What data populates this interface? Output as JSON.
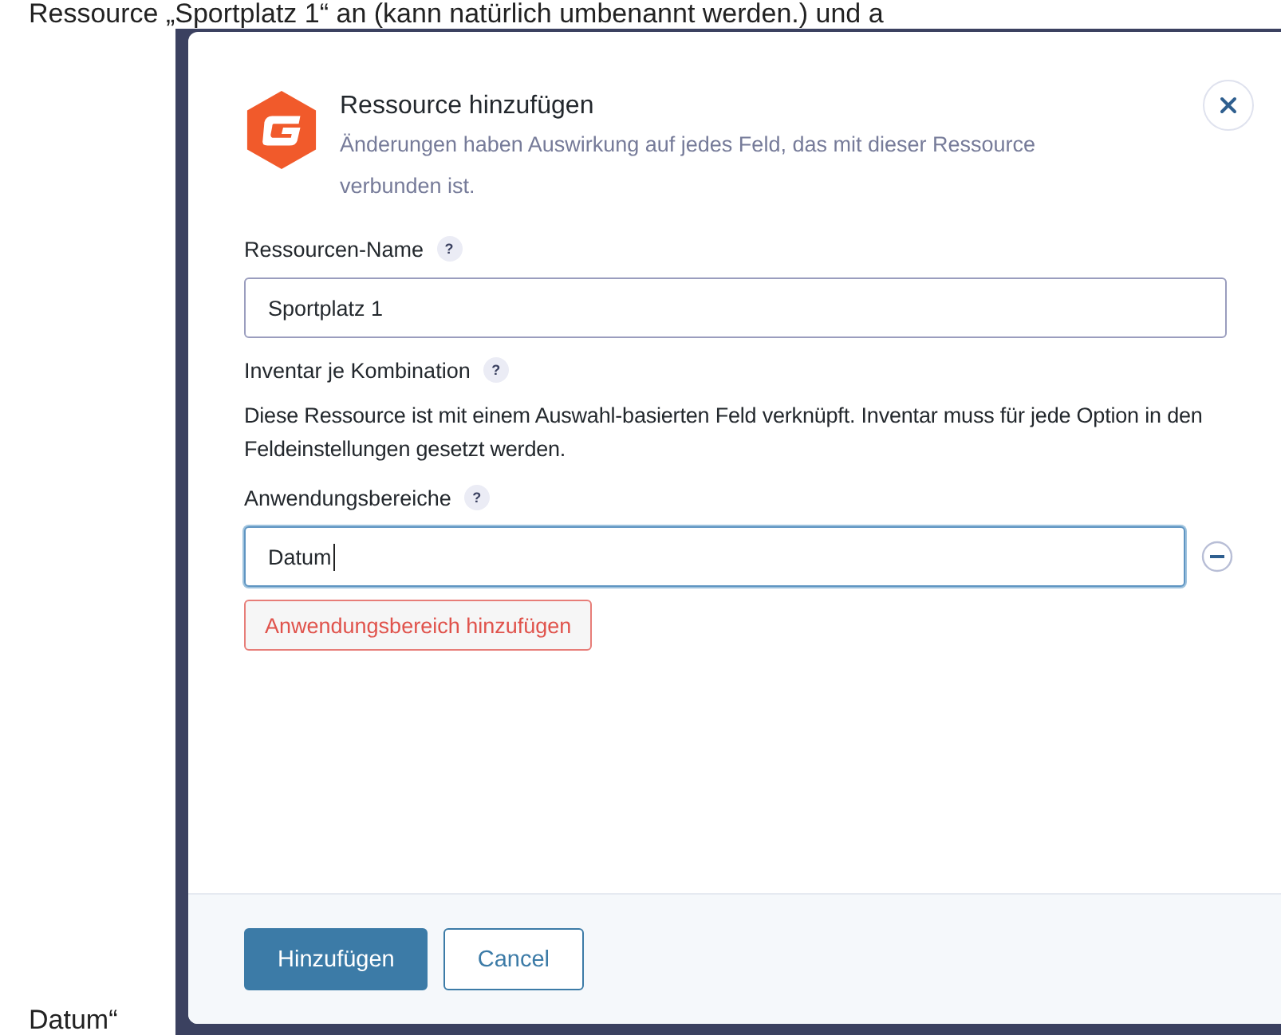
{
  "background_text": {
    "top_line": "Ressource „Sportplatz 1“ an (kann natürlich umbenannt werden.) und a",
    "bottom_line": "Datum“"
  },
  "dialog": {
    "title": "Ressource hinzufügen",
    "subtitle": "Änderungen haben Auswirkung auf jedes Feld, das mit dieser Ressource verbunden ist.",
    "fields": [
      {
        "kind": "text",
        "label": "Ressourcen-Name",
        "help": "?",
        "value": "Sportplatz 1",
        "focused": false
      },
      {
        "kind": "note",
        "label": "Inventar je Kombination",
        "help": "?",
        "text": "Diese Ressource ist mit einem Auswahl-basierten Feld verknüpft. Inventar muss für jede Option in den Feldeinstellungen gesetzt werden."
      },
      {
        "kind": "scopes",
        "label": "Anwendungsbereiche",
        "help": "?",
        "values": [
          {
            "value": "Datum",
            "focused": true
          }
        ],
        "add_button": "Anwendungsbereich hinzufügen"
      }
    ],
    "buttons": [
      {
        "label": "Hinzufügen",
        "primary": true
      },
      {
        "label": "Cancel",
        "primary": false
      }
    ]
  }
}
